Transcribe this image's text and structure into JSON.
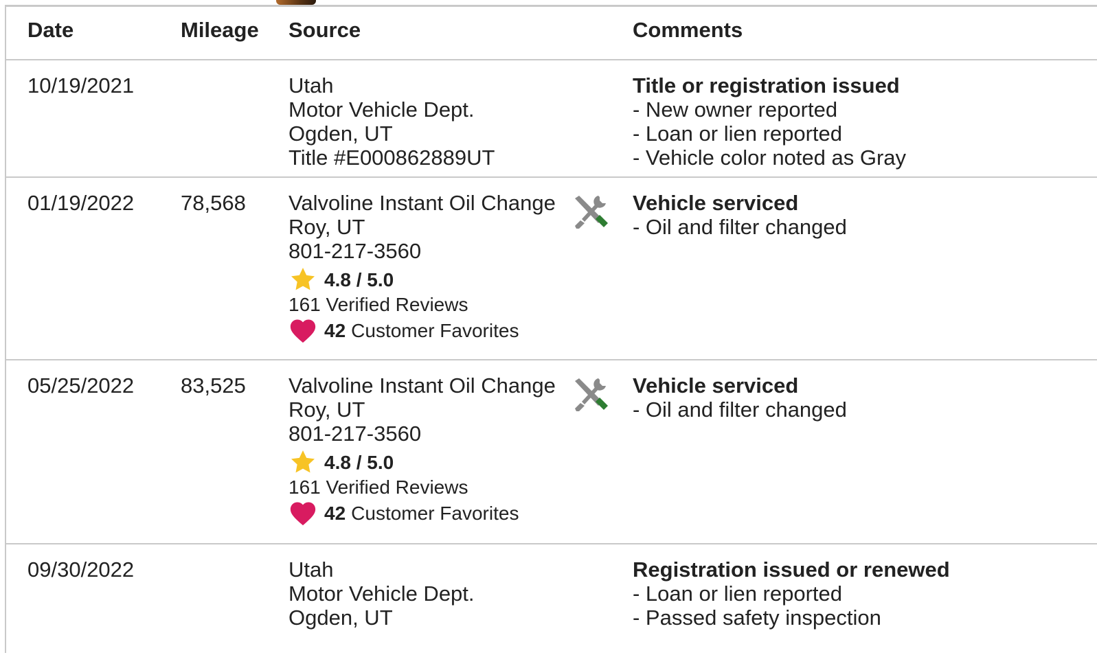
{
  "columns": {
    "date": "Date",
    "mileage": "Mileage",
    "source": "Source",
    "comments": "Comments"
  },
  "records": [
    {
      "date": "10/19/2021",
      "mileage": "",
      "source": [
        "Utah",
        "Motor Vehicle Dept.",
        "Ogden, UT",
        "Title #E000862889UT"
      ],
      "comment_title": "Title or registration issued",
      "comment_items": [
        "- New owner reported",
        "- Loan or lien reported",
        "- Vehicle color noted as Gray"
      ]
    },
    {
      "date": "01/19/2022",
      "mileage": "78,568",
      "source": [
        "Valvoline Instant Oil Change",
        "Roy, UT",
        "801-217-3560"
      ],
      "rating": "4.8 / 5.0",
      "reviews": "161 Verified Reviews",
      "favorites_count": "42",
      "favorites_label": "Customer Favorites",
      "service_icon": "tools-icon",
      "comment_title": "Vehicle serviced",
      "comment_items": [
        "- Oil and filter changed"
      ]
    },
    {
      "date": "05/25/2022",
      "mileage": "83,525",
      "source": [
        "Valvoline Instant Oil Change",
        "Roy, UT",
        "801-217-3560"
      ],
      "rating": "4.8 / 5.0",
      "reviews": "161 Verified Reviews",
      "favorites_count": "42",
      "favorites_label": "Customer Favorites",
      "service_icon": "tools-icon",
      "comment_title": "Vehicle serviced",
      "comment_items": [
        "- Oil and filter changed"
      ]
    },
    {
      "date": "09/30/2022",
      "mileage": "",
      "source": [
        "Utah",
        "Motor Vehicle Dept.",
        "Ogden, UT"
      ],
      "comment_title": "Registration issued or renewed",
      "comment_items": [
        "- Loan or lien reported",
        "- Passed safety inspection"
      ]
    }
  ],
  "colors": {
    "star": "#f7c325",
    "heart": "#d81b60",
    "wrench": "#8a8a8a",
    "screwdriver": "#2e7d32",
    "divider": "#c9c9c9"
  }
}
